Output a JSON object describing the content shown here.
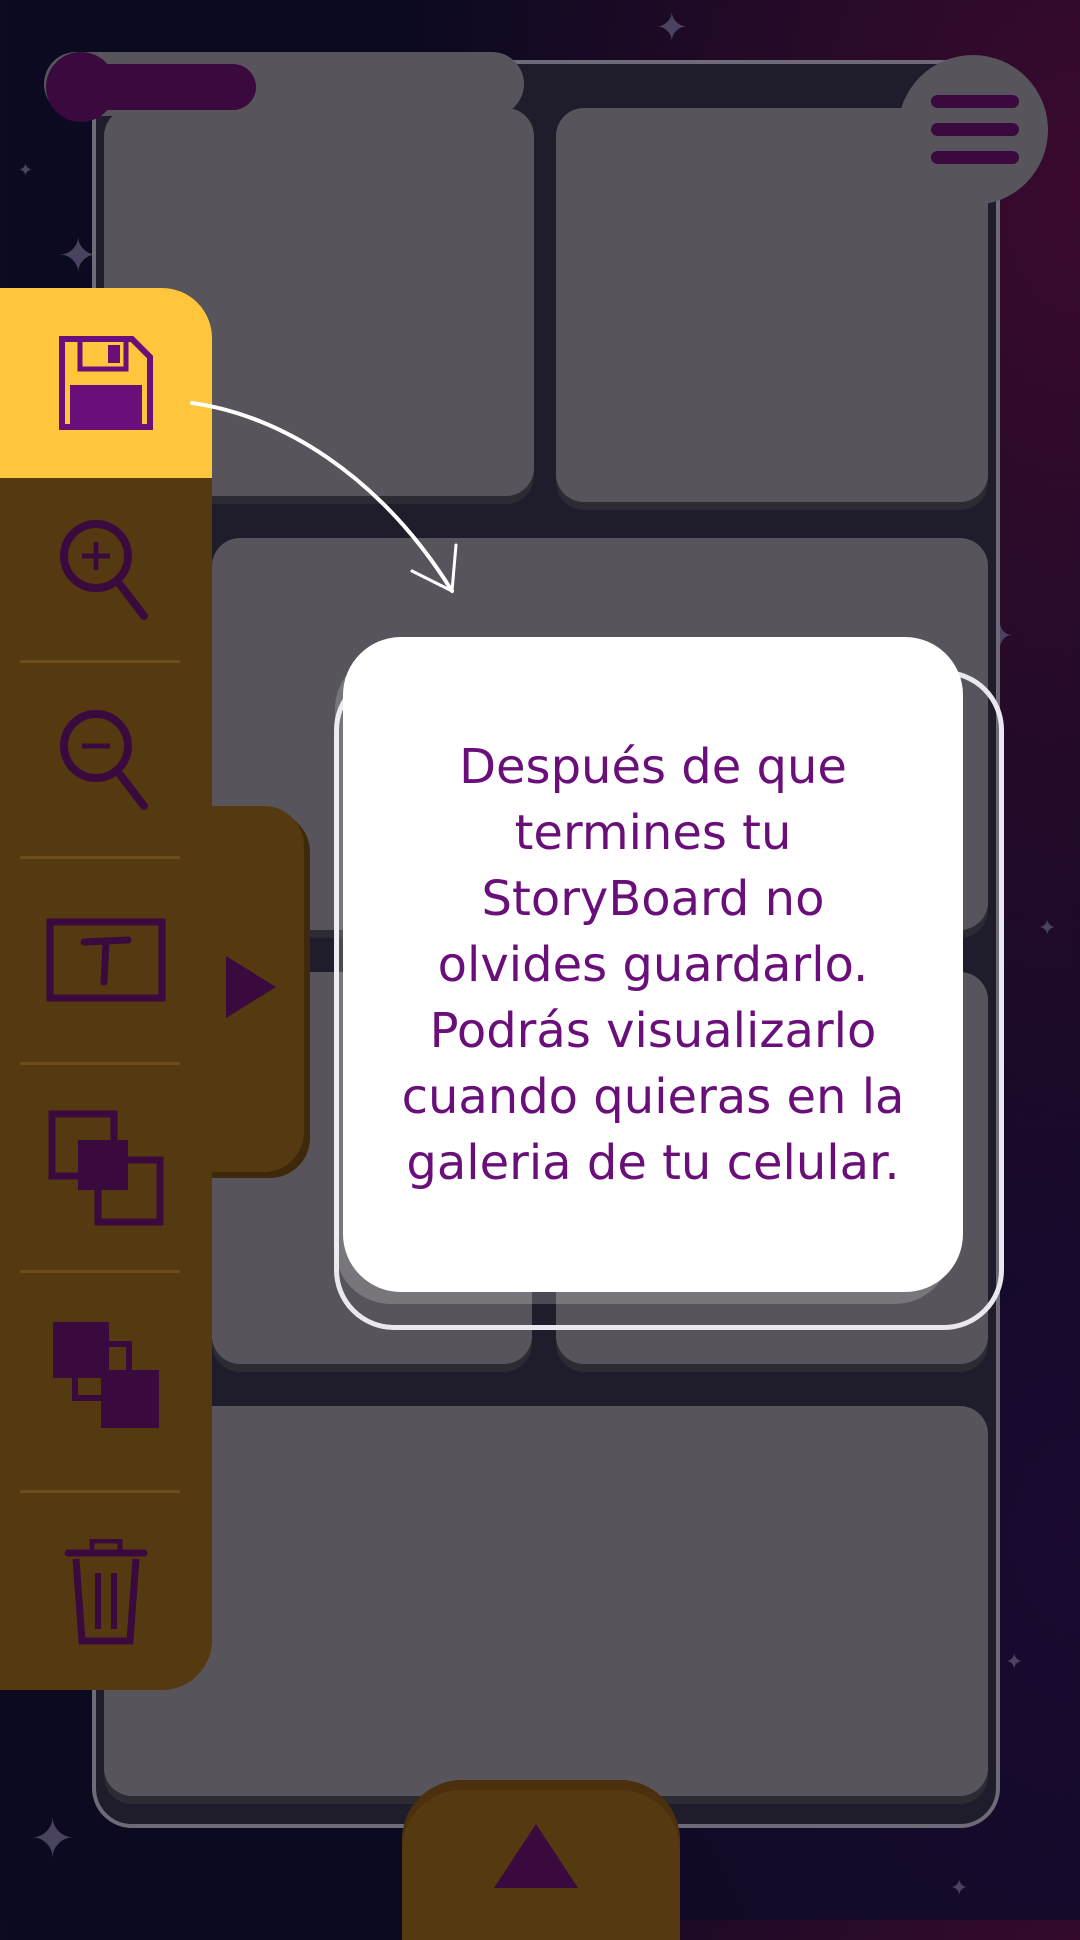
{
  "tooltip": {
    "text": "Después de que termines tu StoryBoard no olvides guardarlo. Podrás visualizarlo cuando quieras en la galeria de tu celular."
  },
  "toolbar": {
    "items": [
      {
        "icon": "floppy-disk-icon",
        "label": "save",
        "active": true
      },
      {
        "icon": "zoom-in-icon",
        "label": "zoom in"
      },
      {
        "icon": "zoom-out-icon",
        "label": "zoom out"
      },
      {
        "icon": "text-box-icon",
        "label": "text"
      },
      {
        "icon": "bring-forward-icon",
        "label": "bring forward"
      },
      {
        "icon": "send-backward-icon",
        "label": "send backward"
      },
      {
        "icon": "trash-icon",
        "label": "delete"
      }
    ]
  },
  "colors": {
    "accent": "#ffc53c",
    "toolbar": "#553910",
    "panel": "#57545b",
    "icon": "#3a0a3e",
    "text": "#6a0f7a"
  },
  "progress": 0.35
}
